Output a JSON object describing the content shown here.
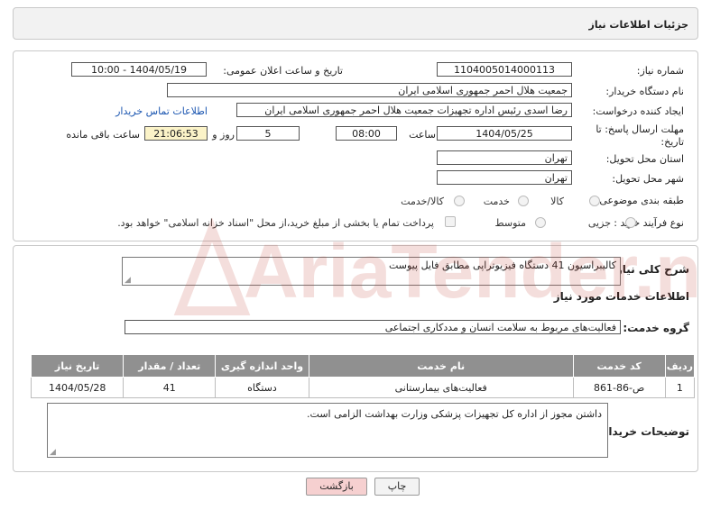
{
  "header": {
    "title": "جزئیات اطلاعات نیاز"
  },
  "form": {
    "need_number_label": "شماره نیاز:",
    "need_number": "1104005014000113",
    "announce_label": "تاریخ و ساعت اعلان عمومی:",
    "announce_value": "1404/05/19 - 10:00",
    "buyer_label": "نام دستگاه خریدار:",
    "buyer_value": "جمعیت هلال احمر جمهوری اسلامی ایران",
    "creator_label": "ایجاد کننده درخواست:",
    "creator_value": "رضا اسدی رئیس اداره تجهیزات جمعیت هلال احمر جمهوری اسلامی ایران",
    "contact_link": "اطلاعات تماس خریدار",
    "deadline_label": "مهلت ارسال پاسخ: تا تاریخ:",
    "deadline_date": "1404/05/25",
    "time_label": "ساعت",
    "deadline_time": "08:00",
    "days_value": "5",
    "days_label": "روز و",
    "remaining_value": "21:06:53",
    "remaining_label": "ساعت باقی مانده",
    "province_label": "استان محل تحویل:",
    "province_value": "تهران",
    "city_label": "شهر محل تحویل:",
    "city_value": "تهران",
    "category_label": "طبقه بندی موضوعی:",
    "category_options": [
      "کالا",
      "خدمت",
      "کالا/خدمت"
    ],
    "process_label": "نوع فرآیند خرید :",
    "process_options": [
      "جزیی",
      "متوسط"
    ],
    "payment_text": "پرداخت تمام یا بخشی از مبلغ خرید،از محل \"اسناد خزانه اسلامی\" خواهد بود."
  },
  "details": {
    "summary_label": "شرح کلی نیاز:",
    "summary_value": "کالیبراسیون 41 دستگاه فیزیوتراپی مطابق فایل پیوست",
    "services_title": "اطلاعات خدمات مورد نیاز",
    "service_group_label": "گروه خدمت:",
    "service_group_value": "فعالیت‌های مربوط به سلامت انسان و مددکاری اجتماعی",
    "table": {
      "headers": [
        "ردیف",
        "کد خدمت",
        "نام خدمت",
        "واحد اندازه گیری",
        "تعداد / مقدار",
        "تاریخ نیاز"
      ],
      "rows": [
        [
          "1",
          "ص-86-861",
          "فعالیت‌های بیمارستانی",
          "دستگاه",
          "41",
          "1404/05/28"
        ]
      ]
    },
    "notes_label": "توضیحات خریدار:",
    "notes_value": "داشتن مجوز از اداره کل تجهیزات پزشکی وزارت بهداشت الزامی است."
  },
  "buttons": {
    "print": "چاپ",
    "back": "بازگشت"
  },
  "watermark": {
    "text": "AriaTender.net"
  },
  "colors": {
    "header_bg": "#f2f2f2",
    "table_header": "#909090",
    "link": "#1a55b0",
    "back_btn": "#f6d0d0",
    "watermark": "#c0392b"
  }
}
